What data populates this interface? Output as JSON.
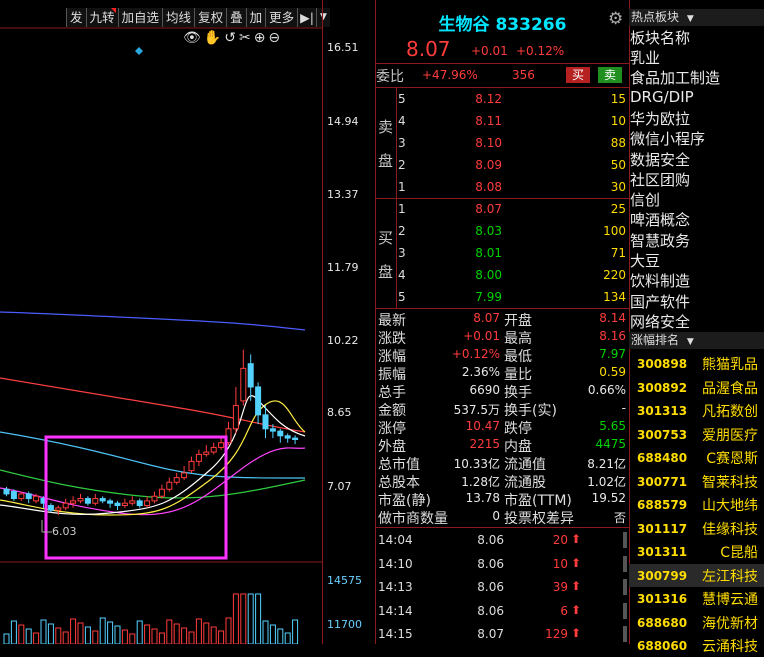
{
  "toolbar": {
    "items": [
      "发",
      "九转",
      "加自选",
      "均线",
      "复权",
      "叠",
      "加",
      "更多"
    ],
    "icons": [
      "eye-icon",
      "hand-icon",
      "undo-icon",
      "scissors-icon",
      "zoom-in-icon",
      "zoom-out-icon"
    ]
  },
  "price_axis": {
    "labels": [
      "16.51",
      "14.94",
      "13.37",
      "11.79",
      "10.22",
      "8.65",
      "7.07"
    ],
    "volume_labels": [
      "14575",
      "11700"
    ],
    "low_marker": "6.03"
  },
  "chart_data": {
    "type": "candlestick",
    "ylim": [
      6.03,
      16.51
    ],
    "price_ticks": [
      16.51,
      14.94,
      13.37,
      11.79,
      10.22,
      8.65,
      7.07
    ],
    "volume_ticks": [
      14575,
      11700
    ],
    "low_annotation": 6.03,
    "highlight_box": true
  },
  "header": {
    "name": "生物谷",
    "code": "833266",
    "price": "8.07",
    "change": "+0.01",
    "change_pct": "+0.12%"
  },
  "ratio": {
    "label": "委比",
    "value": "+47.96%",
    "diff": "356",
    "buy_btn": "买",
    "sell_btn": "卖"
  },
  "sell_orders": {
    "side_label": [
      "卖",
      "盘"
    ],
    "rows": [
      {
        "level": "5",
        "price": "8.12",
        "vol": "15"
      },
      {
        "level": "4",
        "price": "8.11",
        "vol": "10"
      },
      {
        "level": "3",
        "price": "8.10",
        "vol": "88"
      },
      {
        "level": "2",
        "price": "8.09",
        "vol": "50"
      },
      {
        "level": "1",
        "price": "8.08",
        "vol": "30"
      }
    ]
  },
  "buy_orders": {
    "side_label": [
      "买",
      "盘"
    ],
    "rows": [
      {
        "level": "1",
        "price": "8.07",
        "vol": "25"
      },
      {
        "level": "2",
        "price": "8.03",
        "vol": "100"
      },
      {
        "level": "3",
        "price": "8.01",
        "vol": "71"
      },
      {
        "level": "4",
        "price": "8.00",
        "vol": "220"
      },
      {
        "level": "5",
        "price": "7.99",
        "vol": "134"
      }
    ]
  },
  "stats": [
    {
      "l1": "最新",
      "v1": "8.07",
      "c1": "red",
      "l2": "开盘",
      "v2": "8.14",
      "c2": "red"
    },
    {
      "l1": "涨跌",
      "v1": "+0.01",
      "c1": "red",
      "l2": "最高",
      "v2": "8.16",
      "c2": "red"
    },
    {
      "l1": "涨幅",
      "v1": "+0.12%",
      "c1": "red",
      "l2": "最低",
      "v2": "7.97",
      "c2": "green"
    },
    {
      "l1": "振幅",
      "v1": "2.36%",
      "c1": "white",
      "l2": "量比",
      "v2": "0.59",
      "c2": "yellow"
    },
    {
      "l1": "总手",
      "v1": "6690",
      "c1": "white",
      "l2": "换手",
      "v2": "0.66%",
      "c2": "white"
    },
    {
      "l1": "金额",
      "v1": "537.5万",
      "c1": "white",
      "l2": "换手(实)",
      "v2": "-",
      "c2": "white"
    },
    {
      "l1": "涨停",
      "v1": "10.47",
      "c1": "red",
      "l2": "跌停",
      "v2": "5.65",
      "c2": "green"
    },
    {
      "l1": "外盘",
      "v1": "2215",
      "c1": "red",
      "l2": "内盘",
      "v2": "4475",
      "c2": "green"
    },
    {
      "l1": "总市值",
      "v1": "10.33亿",
      "c1": "white",
      "l2": "流通值",
      "v2": "8.21亿",
      "c2": "white"
    },
    {
      "l1": "总股本",
      "v1": "1.28亿",
      "c1": "white",
      "l2": "流通股",
      "v2": "1.02亿",
      "c2": "white"
    },
    {
      "l1": "市盈(静)",
      "v1": "13.78",
      "c1": "white",
      "l2": "市盈(TTM)",
      "v2": "19.52",
      "c2": "white"
    },
    {
      "l1": "做市商数量",
      "v1": "0",
      "c1": "white",
      "l2": "投票权差异",
      "v2": "否",
      "c2": "white"
    }
  ],
  "ticks": [
    {
      "time": "14:04",
      "price": "8.06",
      "vol": "20",
      "dir": "up"
    },
    {
      "time": "14:10",
      "price": "8.06",
      "vol": "10",
      "dir": "up"
    },
    {
      "time": "14:13",
      "price": "8.06",
      "vol": "39",
      "dir": "up"
    },
    {
      "time": "14:14",
      "price": "8.06",
      "vol": "6",
      "dir": "up"
    },
    {
      "time": "14:15",
      "price": "8.07",
      "vol": "129",
      "dir": "up"
    }
  ],
  "hot_sectors": {
    "title": "热点板块",
    "header": "板块名称",
    "items": [
      "乳业",
      "食品加工制造",
      "DRG/DIP",
      "华为欧拉",
      "微信小程序",
      "数据安全",
      "社区团购",
      "信创",
      "啤酒概念",
      "智慧政务",
      "大豆",
      "饮料制造",
      "国产软件",
      "网络安全"
    ]
  },
  "ranking": {
    "title": "涨幅排名",
    "items": [
      {
        "code": "300898",
        "name": "熊猫乳品"
      },
      {
        "code": "300892",
        "name": "品渥食品"
      },
      {
        "code": "301313",
        "name": "凡拓数创"
      },
      {
        "code": "300753",
        "name": "爱朋医疗"
      },
      {
        "code": "688480",
        "name": "C赛恩斯"
      },
      {
        "code": "300771",
        "name": "智莱科技"
      },
      {
        "code": "688579",
        "name": "山大地纬"
      },
      {
        "code": "301117",
        "name": "佳缘科技"
      },
      {
        "code": "301311",
        "name": "C昆船"
      },
      {
        "code": "300799",
        "name": "左江科技"
      },
      {
        "code": "301316",
        "name": "慧博云通"
      },
      {
        "code": "688680",
        "name": "海优新材"
      },
      {
        "code": "688060",
        "name": "云涌科技"
      }
    ]
  },
  "colors": {
    "up": "#ff3c3c",
    "down": "#00d400",
    "accent": "#00e6ff",
    "border": "#8b1a1a"
  }
}
